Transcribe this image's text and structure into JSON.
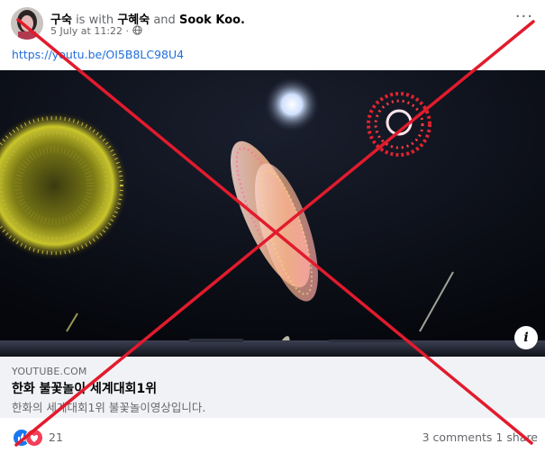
{
  "post": {
    "author": "구숙",
    "with_text": "is with",
    "tagged_1": "구혜숙",
    "and_text": "and",
    "tagged_2": "Sook Koo.",
    "timestamp": "5 July at 11:22",
    "privacy_separator": "·",
    "privacy_icon": "globe-icon",
    "more_icon": "ellipsis-icon",
    "more_label": "···",
    "link_url": "https://youtu.be/OI5B8LC98U4"
  },
  "link_preview": {
    "domain": "YOUTUBE.COM",
    "title": "한화 불꽃놀이 세계대회1위",
    "description": "한화의 세계대회1위 불꽃놀이영상입니다.",
    "info_label": "i",
    "info_icon": "info-icon"
  },
  "footer": {
    "reaction_icons": [
      "like-icon",
      "love-icon"
    ],
    "reaction_count": "21",
    "comments": "3 comments",
    "shares": "1 share"
  },
  "overlay": {
    "mark": "red-x",
    "color": "#e21b2d"
  },
  "colors": {
    "link": "#216fdb",
    "secondary_text": "#65676b",
    "card_background": "#f0f2f5",
    "like": "#1877f2",
    "love": "#f33e58"
  }
}
